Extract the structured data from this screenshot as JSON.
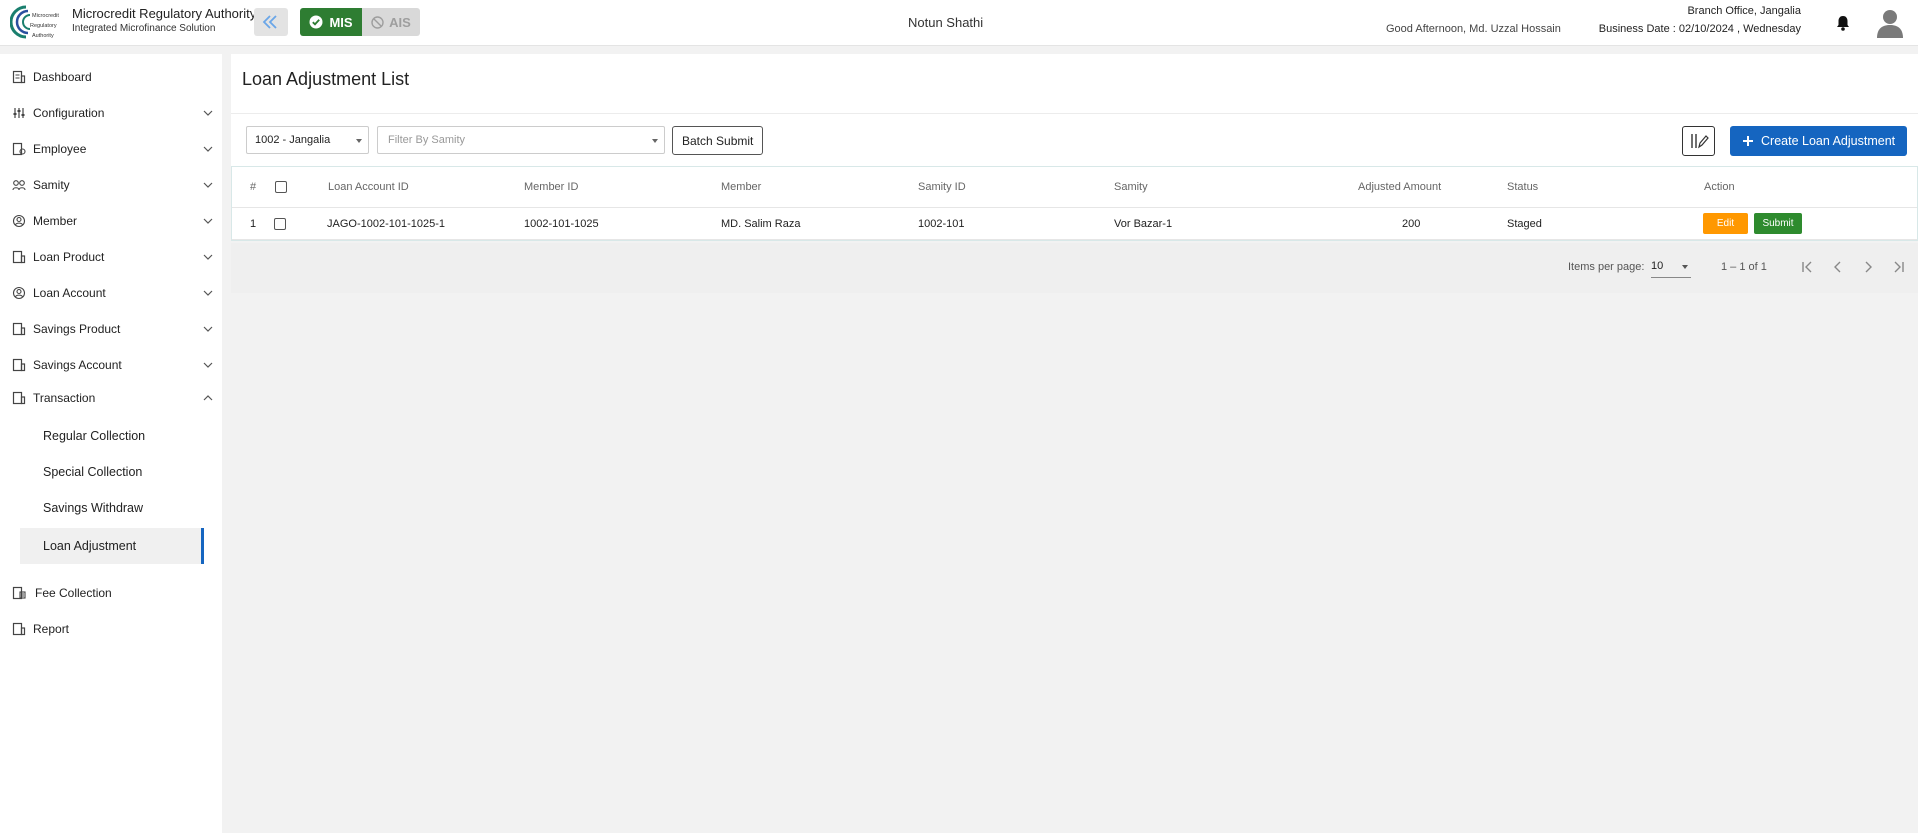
{
  "header": {
    "brand_title": "Microcredit Regulatory Authority",
    "brand_subtitle": "Integrated Microfinance Solution",
    "logo_text": [
      "Microcredit",
      "Regulatory",
      "Authority"
    ],
    "mis_label": "MIS",
    "ais_label": "AIS",
    "app_name": "Notun Shathi",
    "greeting": "Good Afternoon, Md. Uzzal Hossain",
    "office": "Branch Office, Jangalia",
    "business_date": "Business Date : 02/10/2024 , Wednesday"
  },
  "sidebar": {
    "items": [
      {
        "label": "Dashboard",
        "icon": "dashboard-icon",
        "chevron": "none"
      },
      {
        "label": "Configuration",
        "icon": "sliders-icon",
        "chevron": "down"
      },
      {
        "label": "Employee",
        "icon": "employee-icon",
        "chevron": "down"
      },
      {
        "label": "Samity",
        "icon": "samity-icon",
        "chevron": "down"
      },
      {
        "label": "Member",
        "icon": "member-icon",
        "chevron": "down"
      },
      {
        "label": "Loan Product",
        "icon": "loan-product-icon",
        "chevron": "down"
      },
      {
        "label": "Loan Account",
        "icon": "loan-account-icon",
        "chevron": "down"
      },
      {
        "label": "Savings Product",
        "icon": "savings-product-icon",
        "chevron": "down"
      },
      {
        "label": "Savings Account",
        "icon": "savings-account-icon",
        "chevron": "down"
      },
      {
        "label": "Transaction",
        "icon": "transaction-icon",
        "chevron": "up"
      }
    ],
    "transaction_children": [
      {
        "label": "Regular Collection"
      },
      {
        "label": "Special Collection"
      },
      {
        "label": "Savings Withdraw"
      },
      {
        "label": "Loan Adjustment",
        "active": true
      }
    ],
    "bottom_items": [
      {
        "label": "Fee Collection",
        "icon": "fee-collection-icon"
      },
      {
        "label": "Report",
        "icon": "report-icon"
      }
    ]
  },
  "page": {
    "title": "Loan Adjustment List",
    "branch_select": "1002 - Jangalia",
    "samity_placeholder": "Filter By Samity",
    "batch_submit": "Batch Submit",
    "create_button": "Create Loan Adjustment"
  },
  "table": {
    "headers": [
      "#",
      "Loan Account ID",
      "Member ID",
      "Member",
      "Samity ID",
      "Samity",
      "Adjusted Amount",
      "Status",
      "Action"
    ],
    "rows": [
      {
        "index": "1",
        "loan_account_id": "JAGO-1002-101-1025-1",
        "member_id": "1002-101-1025",
        "member": "MD. Salim Raza",
        "samity_id": "1002-101",
        "samity": "Vor Bazar-1",
        "adjusted_amount": "200",
        "status": "Staged"
      }
    ],
    "edit_label": "Edit",
    "submit_label": "Submit"
  },
  "paginator": {
    "items_per_page_label": "Items per page:",
    "page_size": "10",
    "range": "1 – 1 of 1"
  },
  "colors": {
    "primary": "#1565c0",
    "mis_green": "#2e7d32",
    "edit_orange": "#ff9800",
    "submit_green": "#2e8b2e"
  }
}
